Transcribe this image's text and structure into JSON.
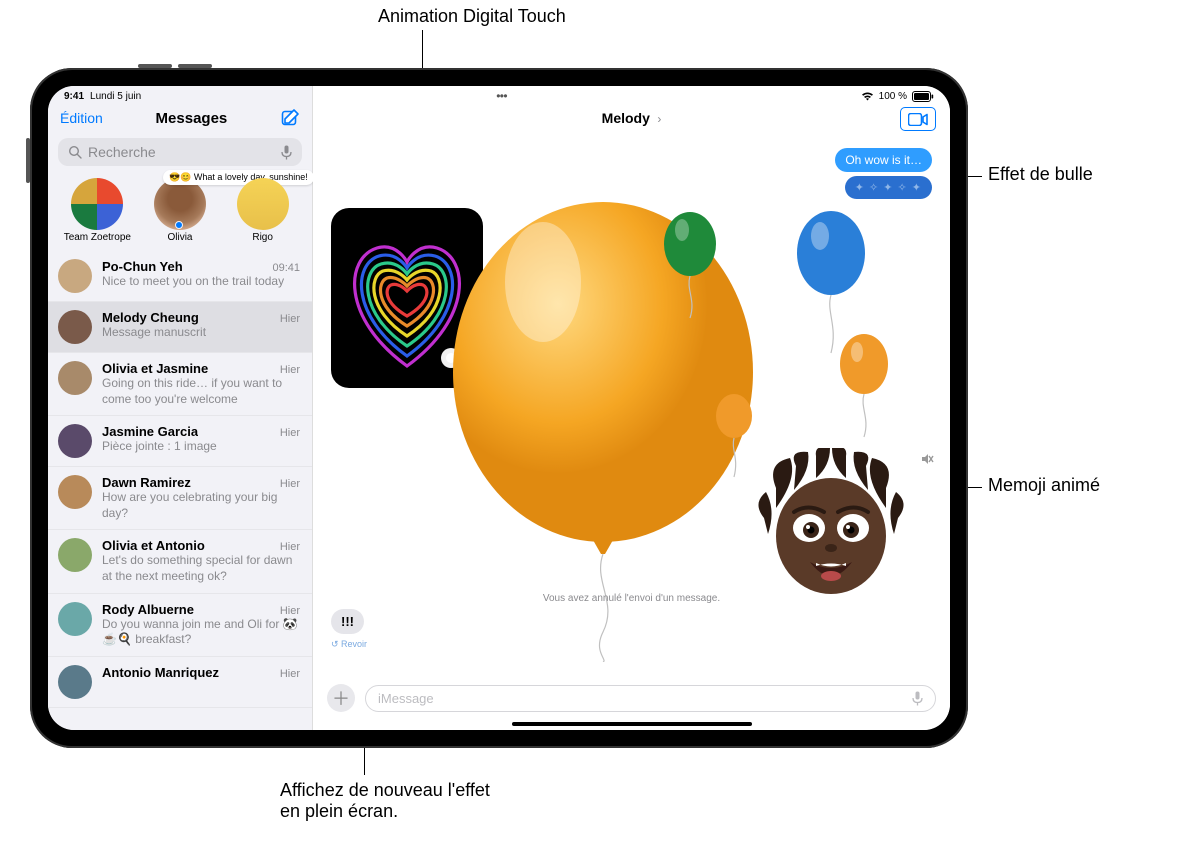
{
  "callouts": {
    "digital_touch": "Animation Digital Touch",
    "bubble_effect": "Effet de bulle",
    "memoji": "Memoji animé",
    "replay_fullscreen": "Affichez de nouveau l'effet\nen plein écran."
  },
  "status": {
    "time": "9:41",
    "date": "Lundi 5 juin",
    "battery_label": "100 %"
  },
  "sidebar": {
    "edit": "Édition",
    "title": "Messages",
    "search_placeholder": "Recherche",
    "pinned": [
      {
        "name": "Team Zoetrope"
      },
      {
        "name": "Olivia",
        "mini_bubble": "😎😊 What a lovely day, sunshine!"
      },
      {
        "name": "Rigo"
      }
    ],
    "conversations": [
      {
        "name": "Po-Chun Yeh",
        "time": "09:41",
        "preview": "Nice to meet you on the trail today"
      },
      {
        "name": "Melody Cheung",
        "time": "Hier",
        "preview": "Message manuscrit",
        "selected": true
      },
      {
        "name": "Olivia et Jasmine",
        "time": "Hier",
        "preview": "Going on this ride… if you want to come too you're welcome"
      },
      {
        "name": "Jasmine Garcia",
        "time": "Hier",
        "preview": "Pièce jointe : 1 image"
      },
      {
        "name": "Dawn Ramirez",
        "time": "Hier",
        "preview": "How are you celebrating your big day?"
      },
      {
        "name": "Olivia et Antonio",
        "time": "Hier",
        "preview": "Let's do something special for dawn at the next meeting ok?"
      },
      {
        "name": "Rody Albuerne",
        "time": "Hier",
        "preview": "Do you wanna join me and Oli for 🐼☕🍳 breakfast?"
      },
      {
        "name": "Antonio Manriquez",
        "time": "Hier",
        "preview": ""
      }
    ]
  },
  "main": {
    "contact": "Melody",
    "bubble_out_1": "Oh wow is it…",
    "bubble_out_laser": "✦ ✧ ✦ ✧ ✦",
    "status_msg": "Vous avez annulé l'envoi d'un message.",
    "tapback": "!!!",
    "replay": "↺ Revoir",
    "input_placeholder": "iMessage"
  }
}
